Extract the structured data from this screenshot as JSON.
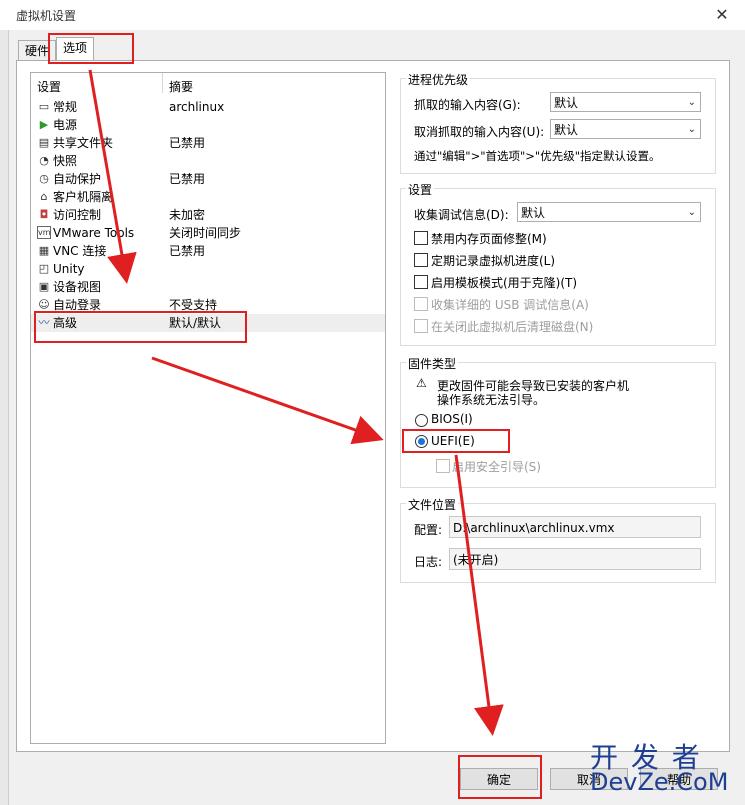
{
  "window": {
    "title": "虚拟机设置",
    "close": "✕"
  },
  "tabs": [
    {
      "label": "硬件"
    },
    {
      "label": "选项"
    }
  ],
  "list": {
    "headers": {
      "setting": "设置",
      "summary": "摘要"
    },
    "items": [
      {
        "name": "常规",
        "summary": "archlinux",
        "icon": "monitor-icon"
      },
      {
        "name": "电源",
        "summary": "",
        "icon": "play-icon"
      },
      {
        "name": "共享文件夹",
        "summary": "已禁用",
        "icon": "folder-icon"
      },
      {
        "name": "快照",
        "summary": "",
        "icon": "snapshot-icon"
      },
      {
        "name": "自动保护",
        "summary": "已禁用",
        "icon": "clock-icon"
      },
      {
        "name": "客户机隔离",
        "summary": "",
        "icon": "lock-icon"
      },
      {
        "name": "访问控制",
        "summary": "未加密",
        "icon": "shield-icon"
      },
      {
        "name": "VMware Tools",
        "summary": "关闭时间同步",
        "icon": "vm-icon"
      },
      {
        "name": "VNC 连接",
        "summary": "已禁用",
        "icon": "vnc-icon"
      },
      {
        "name": "Unity",
        "summary": "",
        "icon": "unity-icon"
      },
      {
        "name": "设备视图",
        "summary": "",
        "icon": "device-icon"
      },
      {
        "name": "自动登录",
        "summary": "不受支持",
        "icon": "user-icon"
      },
      {
        "name": "高级",
        "summary": "默认/默认",
        "icon": "chart-icon"
      }
    ]
  },
  "priority": {
    "title": "进程优先级",
    "grabbed_label": "抓取的输入内容(G):",
    "grabbed_value": "默认",
    "ungrabbed_label": "取消抓取的输入内容(U):",
    "ungrabbed_value": "默认",
    "note": "通过\"编辑\">\"首选项\">\"优先级\"指定默认设置。"
  },
  "settings": {
    "title": "设置",
    "debug_label": "收集调试信息(D):",
    "debug_value": "默认",
    "options": [
      {
        "label": "禁用内存页面修整(M)",
        "enabled": true
      },
      {
        "label": "定期记录虚拟机进度(L)",
        "enabled": true
      },
      {
        "label": "启用模板模式(用于克隆)(T)",
        "enabled": true
      },
      {
        "label": "收集详细的 USB 调试信息(A)",
        "enabled": false
      },
      {
        "label": "在关闭此虚拟机后清理磁盘(N)",
        "enabled": false
      }
    ]
  },
  "firmware": {
    "title": "固件类型",
    "warning_line1": "更改固件可能会导致已安装的客户机",
    "warning_line2": "操作系统无法引导。",
    "bios": "BIOS(I)",
    "uefi": "UEFI(E)",
    "secure_boot": "启用安全引导(S)",
    "selected": "UEFI"
  },
  "file_location": {
    "title": "文件位置",
    "config_label": "配置:",
    "config_value": "D:\\archlinux\\archlinux.vmx",
    "log_label": "日志:",
    "log_value": "(未开启)"
  },
  "buttons": {
    "ok": "确定",
    "cancel": "取消",
    "help": "帮助"
  },
  "watermark": {
    "line1": "开 发 者",
    "line2": "DevZe.CoM"
  },
  "colors": {
    "annotation": "#e02020",
    "accent": "#1a73d9"
  }
}
